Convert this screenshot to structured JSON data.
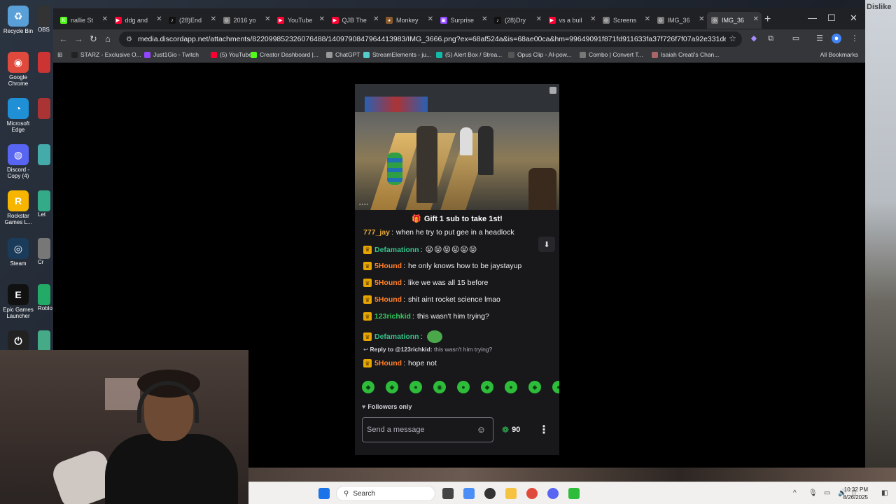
{
  "desktop": {
    "icons": [
      {
        "label": "Recycle Bin",
        "glyph": "♻",
        "color": "#5aa0d8"
      },
      {
        "label": "Google Chrome",
        "glyph": "◉",
        "color": "#e04a3c"
      },
      {
        "label": "Microsoft Edge",
        "glyph": "◔",
        "color": "#1f8fd6"
      },
      {
        "label": "Discord - Copy (4)",
        "glyph": "◍",
        "color": "#5865f2"
      },
      {
        "label": "Rockstar Games L...",
        "glyph": "R",
        "color": "#f7b500"
      },
      {
        "label": "Steam",
        "glyph": "◎",
        "color": "#1b3b5a"
      },
      {
        "label": "Epic Games Launcher",
        "glyph": "E",
        "color": "#111"
      },
      {
        "label": "",
        "glyph": "⏻",
        "color": "#222"
      }
    ],
    "col2_labels": [
      "OBS",
      "",
      "",
      "",
      "Let",
      "Cr",
      "Roblo",
      ""
    ],
    "right_text": "Dislike"
  },
  "browser": {
    "tabs": [
      {
        "title": "nallie St",
        "fav_color": "#53fc18",
        "fav_glyph": "K"
      },
      {
        "title": "ddg and",
        "fav_color": "#ff0033",
        "fav_glyph": "▶"
      },
      {
        "title": "(28)End",
        "fav_color": "#111",
        "fav_glyph": "♪"
      },
      {
        "title": "2016 yo",
        "fav_color": "#777",
        "fav_glyph": "◎"
      },
      {
        "title": "YouTube",
        "fav_color": "#ff0033",
        "fav_glyph": "▶"
      },
      {
        "title": "QJB The",
        "fav_color": "#ff0033",
        "fav_glyph": "▶"
      },
      {
        "title": "Monkey",
        "fav_color": "#8b5a2b",
        "fav_glyph": "◕"
      },
      {
        "title": "Surprise",
        "fav_color": "#9146ff",
        "fav_glyph": "▣"
      },
      {
        "title": "(28)Dry",
        "fav_color": "#111",
        "fav_glyph": "♪"
      },
      {
        "title": "vs a buil",
        "fav_color": "#ff0033",
        "fav_glyph": "▶"
      },
      {
        "title": "Screens",
        "fav_color": "#777",
        "fav_glyph": "◎"
      },
      {
        "title": "IMG_36",
        "fav_color": "#777",
        "fav_glyph": "◎"
      },
      {
        "title": "IMG_36",
        "fav_color": "#777",
        "fav_glyph": "◎"
      }
    ],
    "active_tab_index": 12,
    "url": "media.discordapp.net/attachments/822099852326076488/1409790847964413983/IMG_3666.png?ex=68af524a&is=68ae00ca&hm=99649091f871fd911633fa37f726f7f07a92e331de811d3ed15b539fcc...",
    "bookmarks": [
      {
        "label": "STARZ - Exclusive O...",
        "color": "#222"
      },
      {
        "label": "Just1Gio - Twitch",
        "color": "#9146ff"
      },
      {
        "label": "(5) YouTube",
        "color": "#ff0033"
      },
      {
        "label": "Creator Dashboard |...",
        "color": "#53fc18"
      },
      {
        "label": "ChatGPT",
        "color": "#999"
      },
      {
        "label": "StreamElements - ju...",
        "color": "#5cc"
      },
      {
        "label": "(5) Alert Box / Strea...",
        "color": "#1ba"
      },
      {
        "label": "Opus Clip - AI-pow...",
        "color": "#555"
      },
      {
        "label": "Combo | Convert T...",
        "color": "#777"
      },
      {
        "label": "Isaiah Creati's Chan...",
        "color": "#a66"
      }
    ],
    "all_bookmarks": "All Bookmarks"
  },
  "stream": {
    "gift_banner": "Gift 1 sub to take 1st!",
    "messages": [
      {
        "user": "777_jay",
        "color": "#e6a83a",
        "text": "when he try to put gee in a headlock",
        "badge": false
      },
      {
        "user": "Defamationn",
        "color": "#35c28a",
        "text": "😝😝😝😝😝😝",
        "badge": true
      },
      {
        "user": "5Hound",
        "color": "#ff7f2a",
        "text": "he only knows how to be jaystayup",
        "badge": true
      },
      {
        "user": "5Hound",
        "color": "#ff7f2a",
        "text": "like we was all 15 before",
        "badge": true
      },
      {
        "user": "5Hound",
        "color": "#ff7f2a",
        "text": "shit aint rocket science lmao",
        "badge": true
      },
      {
        "user": "123richkid",
        "color": "#33c85a",
        "text": "this wasn't him trying?",
        "badge": true
      },
      {
        "user": "Defamationn",
        "color": "#35c28a",
        "text": "",
        "badge": true,
        "pepe": true
      }
    ],
    "reply_to": "Reply to @123richkid:",
    "reply_text": "this wasn't him trying?",
    "last_message": {
      "user": "5Hound",
      "color": "#ff7f2a",
      "text": "hope not"
    },
    "followers_only": "Followers only",
    "message_placeholder": "Send a message",
    "points": "90"
  },
  "taskbar": {
    "search_label": "Search",
    "time": "10:32 PM",
    "date": "8/26/2025"
  }
}
